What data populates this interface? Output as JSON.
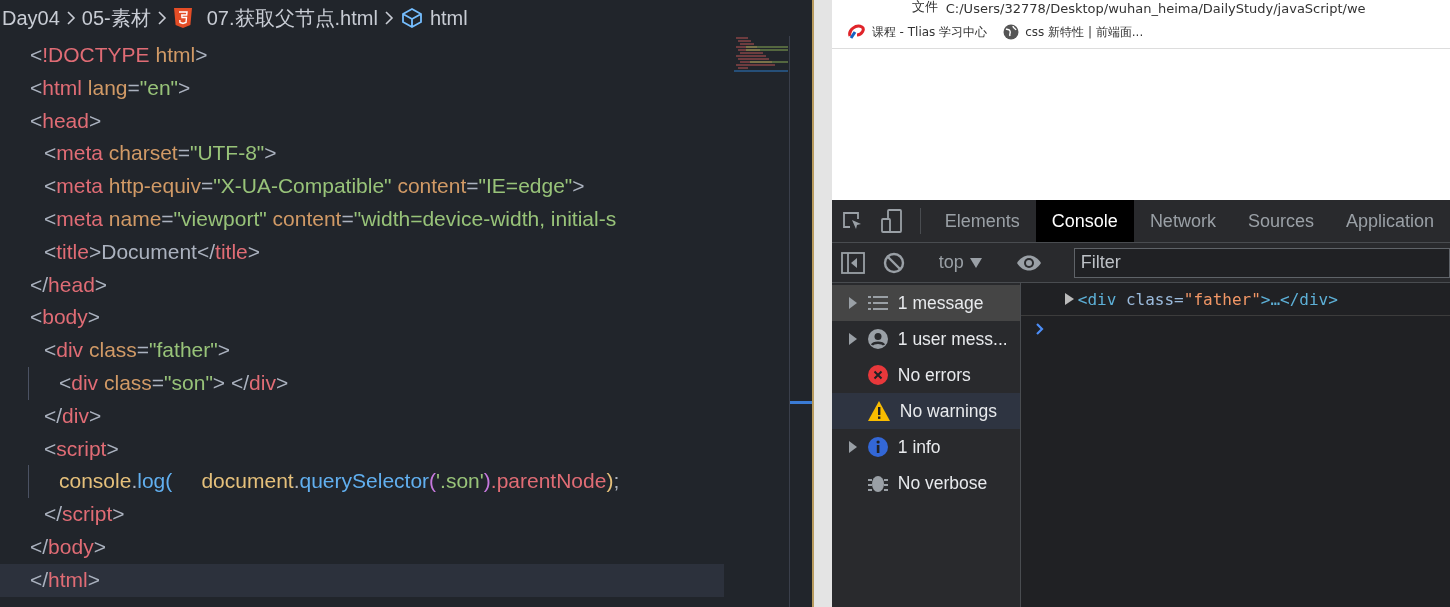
{
  "breadcrumb": [
    {
      "kind": "folder",
      "label": "Day04"
    },
    {
      "kind": "folder",
      "label": "05-素材"
    },
    {
      "kind": "html5",
      "label": "07.获取父节点.html"
    },
    {
      "kind": "element",
      "label": "html"
    }
  ],
  "code": [
    {
      "tokens": [
        {
          "kind": "punct",
          "text": "<"
        },
        {
          "kind": "tag",
          "text": "!DOCTYPE"
        },
        {
          "kind": "attr",
          "text": " html"
        },
        {
          "kind": "punct",
          "text": ">"
        }
      ]
    },
    {
      "tokens": [
        {
          "kind": "punct",
          "text": "<"
        },
        {
          "kind": "tag",
          "text": "html"
        },
        {
          "kind": "attr",
          "text": " lang"
        },
        {
          "kind": "punct",
          "text": "="
        },
        {
          "kind": "string",
          "text": "\"en\""
        },
        {
          "kind": "punct",
          "text": ">"
        }
      ]
    },
    {
      "tokens": [
        {
          "kind": "punct",
          "text": "<"
        },
        {
          "kind": "tag",
          "text": "head"
        },
        {
          "kind": "punct",
          "text": ">"
        }
      ],
      "children": [
        {
          "tokens": [
            {
              "kind": "punct",
              "text": "<"
            },
            {
              "kind": "tag",
              "text": "meta"
            },
            {
              "kind": "attr",
              "text": " charset"
            },
            {
              "kind": "punct",
              "text": "="
            },
            {
              "kind": "string",
              "text": "\"UTF-8\""
            },
            {
              "kind": "punct",
              "text": ">"
            }
          ]
        },
        {
          "tokens": [
            {
              "kind": "punct",
              "text": "<"
            },
            {
              "kind": "tag",
              "text": "meta"
            },
            {
              "kind": "attr",
              "text": " http-equiv"
            },
            {
              "kind": "punct",
              "text": "="
            },
            {
              "kind": "string",
              "text": "\"X-UA-Compatible\""
            },
            {
              "kind": "attr",
              "text": " content"
            },
            {
              "kind": "punct",
              "text": "="
            },
            {
              "kind": "string",
              "text": "\"IE=edge\""
            },
            {
              "kind": "punct",
              "text": ">"
            }
          ]
        },
        {
          "tokens": [
            {
              "kind": "punct",
              "text": "<"
            },
            {
              "kind": "tag",
              "text": "meta"
            },
            {
              "kind": "attr",
              "text": " name"
            },
            {
              "kind": "punct",
              "text": "="
            },
            {
              "kind": "string",
              "text": "\"viewport\""
            },
            {
              "kind": "attr",
              "text": " content"
            },
            {
              "kind": "punct",
              "text": "="
            },
            {
              "kind": "string",
              "text": "\"width=device-width, initial-s"
            }
          ]
        },
        {
          "tokens": [
            {
              "kind": "punct",
              "text": "<"
            },
            {
              "kind": "tag",
              "text": "title"
            },
            {
              "kind": "punct",
              "text": ">"
            },
            {
              "kind": "text",
              "text": "Document"
            },
            {
              "kind": "punct",
              "text": "</"
            },
            {
              "kind": "tag",
              "text": "title"
            },
            {
              "kind": "punct",
              "text": ">"
            }
          ]
        }
      ]
    },
    {
      "tokens": [
        {
          "kind": "punct",
          "text": "</"
        },
        {
          "kind": "tag",
          "text": "head"
        },
        {
          "kind": "punct",
          "text": ">"
        }
      ]
    },
    {
      "tokens": [
        {
          "kind": "punct",
          "text": "<"
        },
        {
          "kind": "tag",
          "text": "body"
        },
        {
          "kind": "punct",
          "text": ">"
        }
      ],
      "children": [
        {
          "tokens": [
            {
              "kind": "punct",
              "text": "<"
            },
            {
              "kind": "tag",
              "text": "div"
            },
            {
              "kind": "attr",
              "text": " class"
            },
            {
              "kind": "punct",
              "text": "="
            },
            {
              "kind": "string",
              "text": "\"father\""
            },
            {
              "kind": "punct",
              "text": ">"
            }
          ],
          "children": [
            {
              "tokens": [
                {
                  "kind": "punct",
                  "text": "<"
                },
                {
                  "kind": "tag",
                  "text": "div"
                },
                {
                  "kind": "attr",
                  "text": " class"
                },
                {
                  "kind": "punct",
                  "text": "="
                },
                {
                  "kind": "string",
                  "text": "\"son\""
                },
                {
                  "kind": "punct",
                  "text": "> </"
                },
                {
                  "kind": "tag",
                  "text": "div"
                },
                {
                  "kind": "punct",
                  "text": ">"
                }
              ]
            }
          ]
        },
        {
          "tokens": [
            {
              "kind": "punct",
              "text": "</"
            },
            {
              "kind": "tag",
              "text": "div"
            },
            {
              "kind": "punct",
              "text": ">"
            }
          ]
        },
        {
          "tokens": [
            {
              "kind": "punct",
              "text": "<"
            },
            {
              "kind": "tag",
              "text": "script"
            },
            {
              "kind": "punct",
              "text": ">"
            }
          ],
          "children": [
            {
              "tokens": [
                {
                  "kind": "object",
                  "text": "console"
                },
                {
                  "kind": "punct",
                  "text": "."
                },
                {
                  "kind": "method",
                  "text": "log"
                },
                {
                  "kind": "method",
                  "text": "("
                },
                {
                  "kind": "object",
                  "text": "     document"
                },
                {
                  "kind": "punct",
                  "text": "."
                },
                {
                  "kind": "method",
                  "text": "querySelector"
                },
                {
                  "kind": "paren",
                  "text": "("
                },
                {
                  "kind": "string",
                  "text": "'.son'"
                },
                {
                  "kind": "paren",
                  "text": ")"
                },
                {
                  "kind": "tag",
                  "text": ".parentNode"
                },
                {
                  "kind": "object",
                  "text": ")"
                },
                {
                  "kind": "punct",
                  "text": ";"
                }
              ]
            }
          ]
        },
        {
          "tokens": [
            {
              "kind": "punct",
              "text": "</"
            },
            {
              "kind": "tag",
              "text": "script"
            },
            {
              "kind": "punct",
              "text": ">"
            }
          ]
        }
      ]
    },
    {
      "tokens": [
        {
          "kind": "punct",
          "text": "</"
        },
        {
          "kind": "tag",
          "text": "body"
        },
        {
          "kind": "punct",
          "text": ">"
        }
      ]
    },
    {
      "tokens": [
        {
          "kind": "punct",
          "text": "</"
        },
        {
          "kind": "tag",
          "text": "html"
        },
        {
          "kind": "punct",
          "text": ">"
        }
      ],
      "current": true
    }
  ],
  "browser": {
    "address_label": "文件",
    "url": "C:/Users/32778/Desktop/wuhan_heima/DailyStudy/javaScript/we",
    "bookmarks": [
      {
        "kind": "site",
        "label": "课程 - Tlias 学习中心"
      },
      {
        "kind": "globe",
        "label": "css 新特性 | 前端面..."
      }
    ]
  },
  "devtools": {
    "tabs": [
      {
        "label": "Elements",
        "selected": false
      },
      {
        "label": "Console",
        "selected": true
      },
      {
        "label": "Network",
        "selected": false
      },
      {
        "label": "Sources",
        "selected": false
      },
      {
        "label": "Application",
        "selected": false
      }
    ],
    "context": "top",
    "filter_placeholder": "Filter",
    "sidebar": [
      {
        "kind": "list",
        "label": "1 message",
        "expandable": true,
        "selected": true,
        "hovered": false
      },
      {
        "kind": "user",
        "label": "1 user mess...",
        "expandable": true,
        "selected": false,
        "hovered": false
      },
      {
        "kind": "error",
        "label": "No errors",
        "expandable": false,
        "selected": false,
        "hovered": false
      },
      {
        "kind": "warning",
        "label": "No warnings",
        "expandable": false,
        "selected": false,
        "hovered": true
      },
      {
        "kind": "info",
        "label": "1 info",
        "expandable": true,
        "selected": false,
        "hovered": false
      },
      {
        "kind": "verbose",
        "label": "No verbose",
        "expandable": false,
        "selected": false,
        "hovered": false
      }
    ],
    "output": [
      {
        "tokens": [
          {
            "kind": "tag",
            "text": "<div"
          },
          {
            "kind": "attr",
            "text": " class"
          },
          {
            "kind": "punct",
            "text": "="
          },
          {
            "kind": "string",
            "text": "\"father\""
          },
          {
            "kind": "tag",
            "text": ">…</div>"
          }
        ]
      }
    ]
  }
}
